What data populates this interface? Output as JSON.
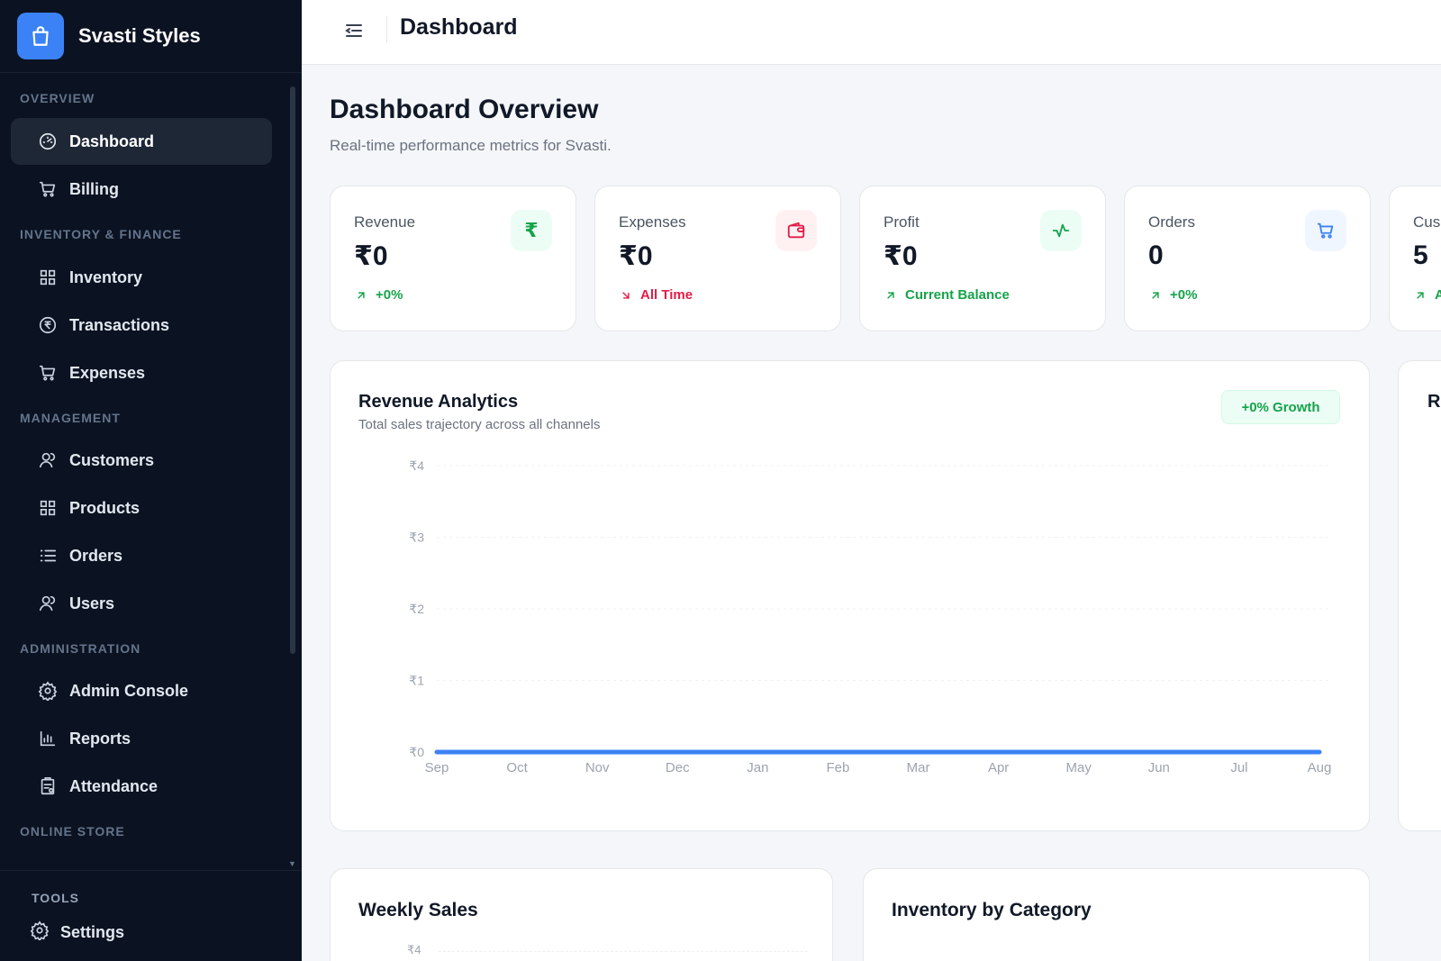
{
  "brand": {
    "name": "Svasti Styles",
    "icon": "shopping-bag-icon",
    "color": "#3b82f6"
  },
  "sidebar": {
    "sections": [
      {
        "title": "OVERVIEW",
        "items": [
          {
            "label": "Dashboard",
            "icon": "gauge-icon",
            "active": true
          },
          {
            "label": "Billing",
            "icon": "cart-icon"
          }
        ]
      },
      {
        "title": "INVENTORY & FINANCE",
        "items": [
          {
            "label": "Inventory",
            "icon": "grid-icon"
          },
          {
            "label": "Transactions",
            "icon": "rupee-circle-icon"
          },
          {
            "label": "Expenses",
            "icon": "cart-icon"
          }
        ]
      },
      {
        "title": "MANAGEMENT",
        "items": [
          {
            "label": "Customers",
            "icon": "users-icon"
          },
          {
            "label": "Products",
            "icon": "grid-icon"
          },
          {
            "label": "Orders",
            "icon": "list-icon"
          },
          {
            "label": "Users",
            "icon": "users-icon"
          }
        ]
      },
      {
        "title": "ADMINISTRATION",
        "items": [
          {
            "label": "Admin Console",
            "icon": "gear-icon"
          },
          {
            "label": "Reports",
            "icon": "bar-chart-icon"
          },
          {
            "label": "Attendance",
            "icon": "clipboard-icon"
          }
        ]
      },
      {
        "title": "ONLINE STORE",
        "items": []
      }
    ],
    "tools": {
      "title": "TOOLS",
      "settings_label": "Settings",
      "settings_icon": "gear-icon"
    }
  },
  "topbar": {
    "title": "Dashboard",
    "menu_icon": "menu-collapse-icon"
  },
  "page": {
    "title": "Dashboard Overview",
    "subtitle": "Real-time performance metrics for Svasti."
  },
  "stats": [
    {
      "label": "Revenue",
      "value": "₹0",
      "foot": "+0%",
      "trend": "up",
      "icon": "rupee-icon",
      "accent": "#16a34a",
      "tint": "#ecfdf5"
    },
    {
      "label": "Expenses",
      "value": "₹0",
      "foot": "All Time",
      "trend": "down",
      "icon": "wallet-icon",
      "accent": "#e11d48",
      "tint": "#fff1f2"
    },
    {
      "label": "Profit",
      "value": "₹0",
      "foot": "Current Balance",
      "trend": "up",
      "icon": "activity-icon",
      "accent": "#16a34a",
      "tint": "#ecfdf5"
    },
    {
      "label": "Orders",
      "value": "0",
      "foot": "+0%",
      "trend": "up",
      "icon": "cart-icon",
      "accent": "#3b82f6",
      "tint": "#eff6ff"
    },
    {
      "label": "Cus",
      "value": "5",
      "foot": "A",
      "trend": "up",
      "icon": "",
      "accent": "#16a34a",
      "tint": "#ecfdf5"
    }
  ],
  "revenue_card": {
    "title": "Revenue Analytics",
    "subtitle": "Total sales trajectory across all channels",
    "badge": "+0% Growth"
  },
  "right_card": {
    "title": "Re"
  },
  "bottom_cards": [
    {
      "title": "Weekly Sales",
      "tick": "₹4"
    },
    {
      "title": "Inventory by Category"
    }
  ],
  "chart_data": {
    "type": "line",
    "title": "Revenue Analytics",
    "categories": [
      "Sep",
      "Oct",
      "Nov",
      "Dec",
      "Jan",
      "Feb",
      "Mar",
      "Apr",
      "May",
      "Jun",
      "Jul",
      "Aug"
    ],
    "series": [
      {
        "values": [
          0,
          0,
          0,
          0,
          0,
          0,
          0,
          0,
          0,
          0,
          0,
          0
        ],
        "color": "#3b82f6"
      }
    ],
    "yticks": [
      "₹0",
      "₹1",
      "₹2",
      "₹3",
      "₹4"
    ],
    "ylim": [
      0,
      4
    ],
    "grid": true
  }
}
